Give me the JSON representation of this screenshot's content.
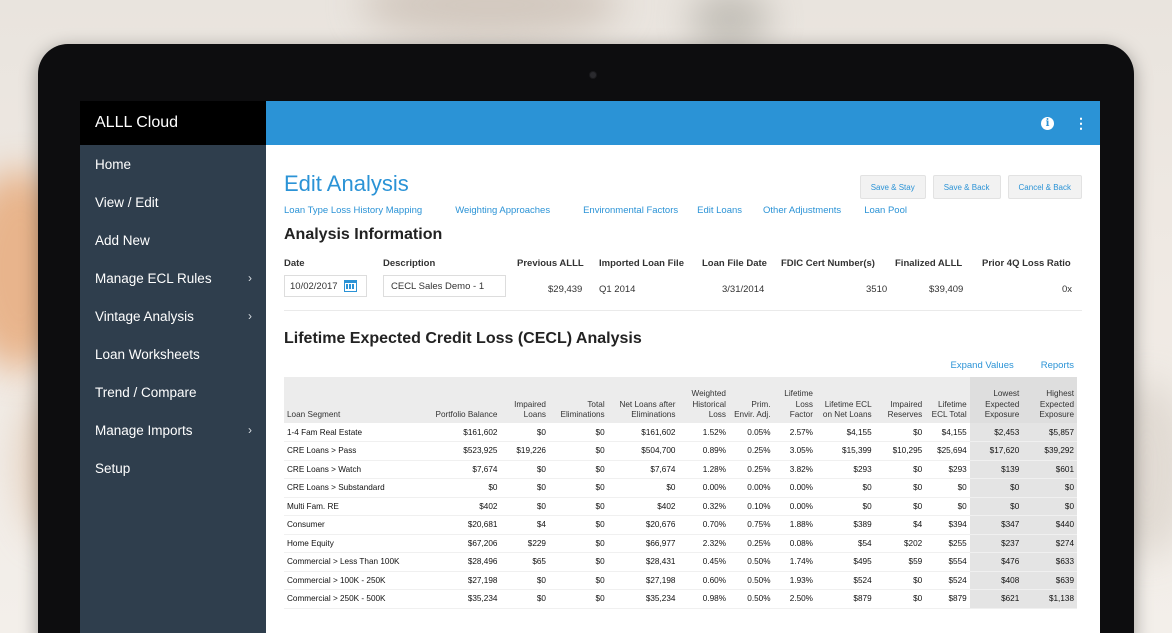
{
  "app": {
    "brand": "ALLL Cloud"
  },
  "sidebar": {
    "items": [
      {
        "label": "Home",
        "has_submenu": false
      },
      {
        "label": "View / Edit",
        "has_submenu": false
      },
      {
        "label": "Add New",
        "has_submenu": false
      },
      {
        "label": "Manage ECL Rules",
        "has_submenu": true
      },
      {
        "label": "Vintage Analysis",
        "has_submenu": true
      },
      {
        "label": "Loan Worksheets",
        "has_submenu": false
      },
      {
        "label": "Trend / Compare",
        "has_submenu": false
      },
      {
        "label": "Manage Imports",
        "has_submenu": true
      },
      {
        "label": "Setup",
        "has_submenu": false
      }
    ],
    "chevron": "›"
  },
  "topbar": {
    "info_glyph": "i",
    "menu_glyph": "⋮"
  },
  "page": {
    "title": "Edit Analysis",
    "buttons": {
      "save_stay": "Save & Stay",
      "save_back": "Save & Back",
      "cancel_back": "Cancel & Back"
    },
    "tabs": [
      "Loan Type Loss History Mapping",
      "Weighting Approaches",
      "Environmental Factors",
      "Edit Loans",
      "Other Adjustments",
      "Loan Pool"
    ]
  },
  "analysis_info": {
    "title": "Analysis Information",
    "labels": {
      "date": "Date",
      "description": "Description",
      "previous_alll": "Previous ALLL",
      "imported_loan_file": "Imported Loan File",
      "loan_file_date": "Loan File Date",
      "fdic_cert": "FDIC Cert Number(s)",
      "finalized_alll": "Finalized ALLL",
      "prior_4q": "Prior 4Q Loss Ratio"
    },
    "values": {
      "date": "10/02/2017",
      "description": "CECL Sales Demo - 1",
      "previous_alll": "$29,439",
      "imported_loan_file": "Q1 2014",
      "loan_file_date": "3/31/2014",
      "fdic_cert": "3510",
      "finalized_alll": "$39,409",
      "prior_4q": "0x"
    }
  },
  "cecl": {
    "title": "Lifetime Expected Credit Loss (CECL) Analysis",
    "links": {
      "expand": "Expand Values",
      "reports": "Reports"
    },
    "columns": [
      "Loan Segment",
      "Portfolio Balance",
      "Impaired Loans",
      "Total Eliminations",
      "Net Loans after Eliminations",
      "Weighted Historical Loss",
      "Prim. Envir. Adj.",
      "Lifetime Loss Factor",
      "Lifetime ECL on Net Loans",
      "Impaired Reserves",
      "Lifetime ECL Total",
      "Lowest Expected Exposure",
      "Highest Expected Exposure"
    ],
    "rows": [
      [
        "1-4 Fam Real Estate",
        "$161,602",
        "$0",
        "$0",
        "$161,602",
        "1.52%",
        "0.05%",
        "2.57%",
        "$4,155",
        "$0",
        "$4,155",
        "$2,453",
        "$5,857"
      ],
      [
        "CRE Loans > Pass",
        "$523,925",
        "$19,226",
        "$0",
        "$504,700",
        "0.89%",
        "0.25%",
        "3.05%",
        "$15,399",
        "$10,295",
        "$25,694",
        "$17,620",
        "$39,292"
      ],
      [
        "CRE Loans > Watch",
        "$7,674",
        "$0",
        "$0",
        "$7,674",
        "1.28%",
        "0.25%",
        "3.82%",
        "$293",
        "$0",
        "$293",
        "$139",
        "$601"
      ],
      [
        "CRE Loans > Substandard",
        "$0",
        "$0",
        "$0",
        "$0",
        "0.00%",
        "0.00%",
        "0.00%",
        "$0",
        "$0",
        "$0",
        "$0",
        "$0"
      ],
      [
        "Multi Fam. RE",
        "$402",
        "$0",
        "$0",
        "$402",
        "0.32%",
        "0.10%",
        "0.00%",
        "$0",
        "$0",
        "$0",
        "$0",
        "$0"
      ],
      [
        "Consumer",
        "$20,681",
        "$4",
        "$0",
        "$20,676",
        "0.70%",
        "0.75%",
        "1.88%",
        "$389",
        "$4",
        "$394",
        "$347",
        "$440"
      ],
      [
        "Home Equity",
        "$67,206",
        "$229",
        "$0",
        "$66,977",
        "2.32%",
        "0.25%",
        "0.08%",
        "$54",
        "$202",
        "$255",
        "$237",
        "$274"
      ],
      [
        "Commercial > Less Than 100K",
        "$28,496",
        "$65",
        "$0",
        "$28,431",
        "0.45%",
        "0.50%",
        "1.74%",
        "$495",
        "$59",
        "$554",
        "$476",
        "$633"
      ],
      [
        "Commercial > 100K - 250K",
        "$27,198",
        "$0",
        "$0",
        "$27,198",
        "0.60%",
        "0.50%",
        "1.93%",
        "$524",
        "$0",
        "$524",
        "$408",
        "$639"
      ],
      [
        "Commercial > 250K - 500K",
        "$35,234",
        "$0",
        "$0",
        "$35,234",
        "0.98%",
        "0.50%",
        "2.50%",
        "$879",
        "$0",
        "$879",
        "$621",
        "$1,138"
      ]
    ]
  }
}
